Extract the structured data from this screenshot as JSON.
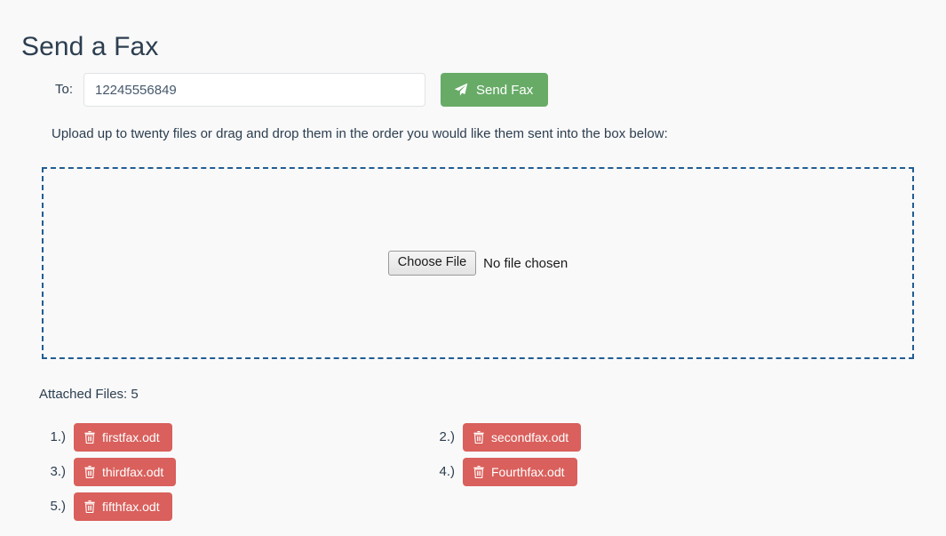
{
  "page": {
    "title": "Send a Fax"
  },
  "form": {
    "to_label": "To:",
    "to_value": "12245556849",
    "to_placeholder": "",
    "send_button_label": "Send Fax",
    "send_button_icon": "paper-plane-icon",
    "send_button_color": "#67ab67"
  },
  "upload": {
    "instructions": "Upload up to twenty files or drag and drop them in the order you would like them sent into the box below:",
    "dropzone_border_color": "#215d93",
    "choose_file_label": "Choose File",
    "no_file_text": "No file chosen"
  },
  "attached": {
    "count_label": "Attached Files: 5",
    "badge_color": "#d9605c",
    "delete_icon": "trash-icon",
    "files": [
      {
        "index": "1.)",
        "name": "firstfax.odt"
      },
      {
        "index": "2.)",
        "name": "secondfax.odt"
      },
      {
        "index": "3.)",
        "name": "thirdfax.odt"
      },
      {
        "index": "4.)",
        "name": "Fourthfax.odt"
      },
      {
        "index": "5.)",
        "name": "fifthfax.odt"
      }
    ]
  }
}
